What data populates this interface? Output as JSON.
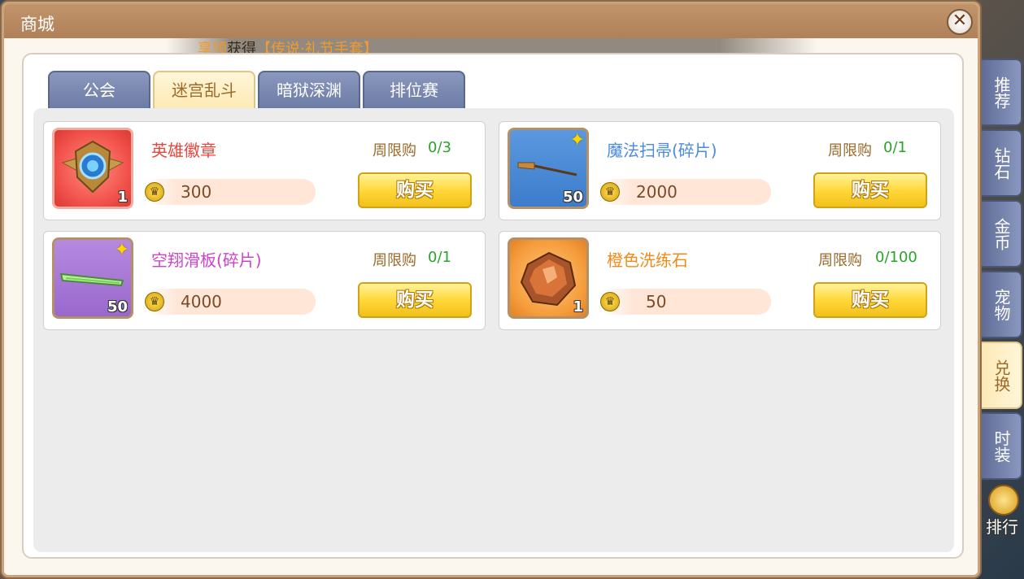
{
  "window": {
    "title": "商城",
    "close_glyph": "✕"
  },
  "notice": {
    "name": "享领",
    "verb": "获得",
    "item": "【传说·礼节手套】"
  },
  "tabs": [
    {
      "label": "公会",
      "active": false
    },
    {
      "label": "迷宫乱斗",
      "active": true
    },
    {
      "label": "暗狱深渊",
      "active": false
    },
    {
      "label": "排位赛",
      "active": false
    }
  ],
  "items": [
    {
      "name": "英雄徽章",
      "name_color": "#e8453c",
      "limit_label": "周限购",
      "limit": "0/3",
      "price": "300",
      "count": "1",
      "icon": "hero-badge-icon",
      "shard": false,
      "buy_label": "购买"
    },
    {
      "name": "魔法扫帚(碎片)",
      "name_color": "#4a8be0",
      "limit_label": "周限购",
      "limit": "0/1",
      "price": "2000",
      "count": "50",
      "icon": "broom-icon",
      "shard": true,
      "buy_label": "购买"
    },
    {
      "name": "空翔滑板(碎片)",
      "name_color": "#cc44cc",
      "limit_label": "周限购",
      "limit": "0/1",
      "price": "4000",
      "count": "50",
      "icon": "skateboard-icon",
      "shard": true,
      "buy_label": "购买"
    },
    {
      "name": "橙色洗练石",
      "name_color": "#f28a1a",
      "limit_label": "周限购",
      "limit": "0/100",
      "price": "50",
      "count": "1",
      "icon": "orange-stone-icon",
      "shard": false,
      "buy_label": "购买"
    }
  ],
  "side_tabs": [
    {
      "label": "推荐",
      "active": false
    },
    {
      "label": "钻石",
      "active": false
    },
    {
      "label": "金币",
      "active": false
    },
    {
      "label": "宠物",
      "active": false
    },
    {
      "label": "兑换",
      "active": true
    },
    {
      "label": "时装",
      "active": false
    }
  ],
  "rank": {
    "label": "排行"
  }
}
